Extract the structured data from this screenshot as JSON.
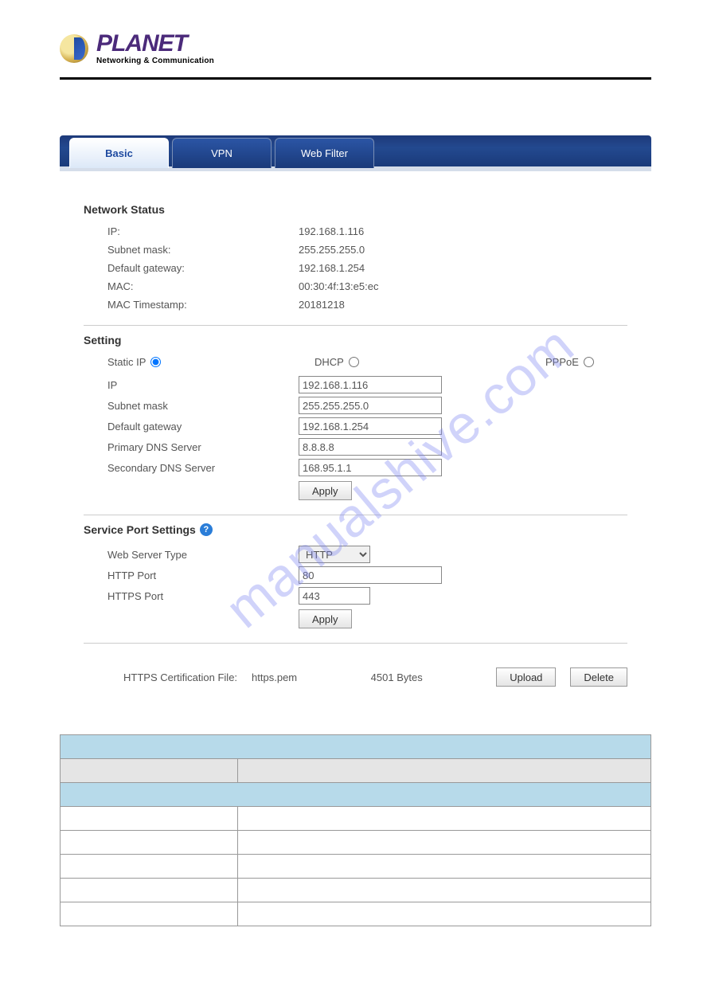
{
  "brand": {
    "name": "PLANET",
    "tagline": "Networking & Communication"
  },
  "tabs": [
    {
      "label": "Basic"
    },
    {
      "label": "VPN"
    },
    {
      "label": "Web Filter"
    }
  ],
  "sections": {
    "network_status": {
      "title": "Network Status",
      "items": [
        {
          "label": "IP:",
          "value": "192.168.1.116"
        },
        {
          "label": "Subnet mask:",
          "value": "255.255.255.0"
        },
        {
          "label": "Default gateway:",
          "value": "192.168.1.254"
        },
        {
          "label": "MAC:",
          "value": "00:30:4f:13:e5:ec"
        },
        {
          "label": "MAC Timestamp:",
          "value": "20181218"
        }
      ]
    },
    "setting": {
      "title": "Setting",
      "modes": [
        {
          "label": "Static IP",
          "checked": true
        },
        {
          "label": "DHCP",
          "checked": false
        },
        {
          "label": "PPPoE",
          "checked": false
        }
      ],
      "fields": [
        {
          "label": "IP",
          "value": "192.168.1.116"
        },
        {
          "label": "Subnet mask",
          "value": "255.255.255.0"
        },
        {
          "label": "Default gateway",
          "value": "192.168.1.254"
        },
        {
          "label": "Primary DNS Server",
          "value": "8.8.8.8"
        },
        {
          "label": "Secondary DNS Server",
          "value": "168.95.1.1"
        }
      ],
      "apply_label": "Apply"
    },
    "service_port": {
      "title": "Service Port Settings",
      "fields": {
        "webserver_label": "Web Server Type",
        "webserver_value": "HTTP",
        "http_port_label": "HTTP Port",
        "http_port_value": "80",
        "https_port_label": "HTTPS Port",
        "https_port_value": "443"
      },
      "apply_label": "Apply"
    },
    "cert": {
      "label": "HTTPS Certification File:",
      "file": "https.pem",
      "size": "4501 Bytes",
      "upload_label": "Upload",
      "delete_label": "Delete"
    }
  },
  "watermark": "manualshive.com",
  "help_glyph": "?"
}
